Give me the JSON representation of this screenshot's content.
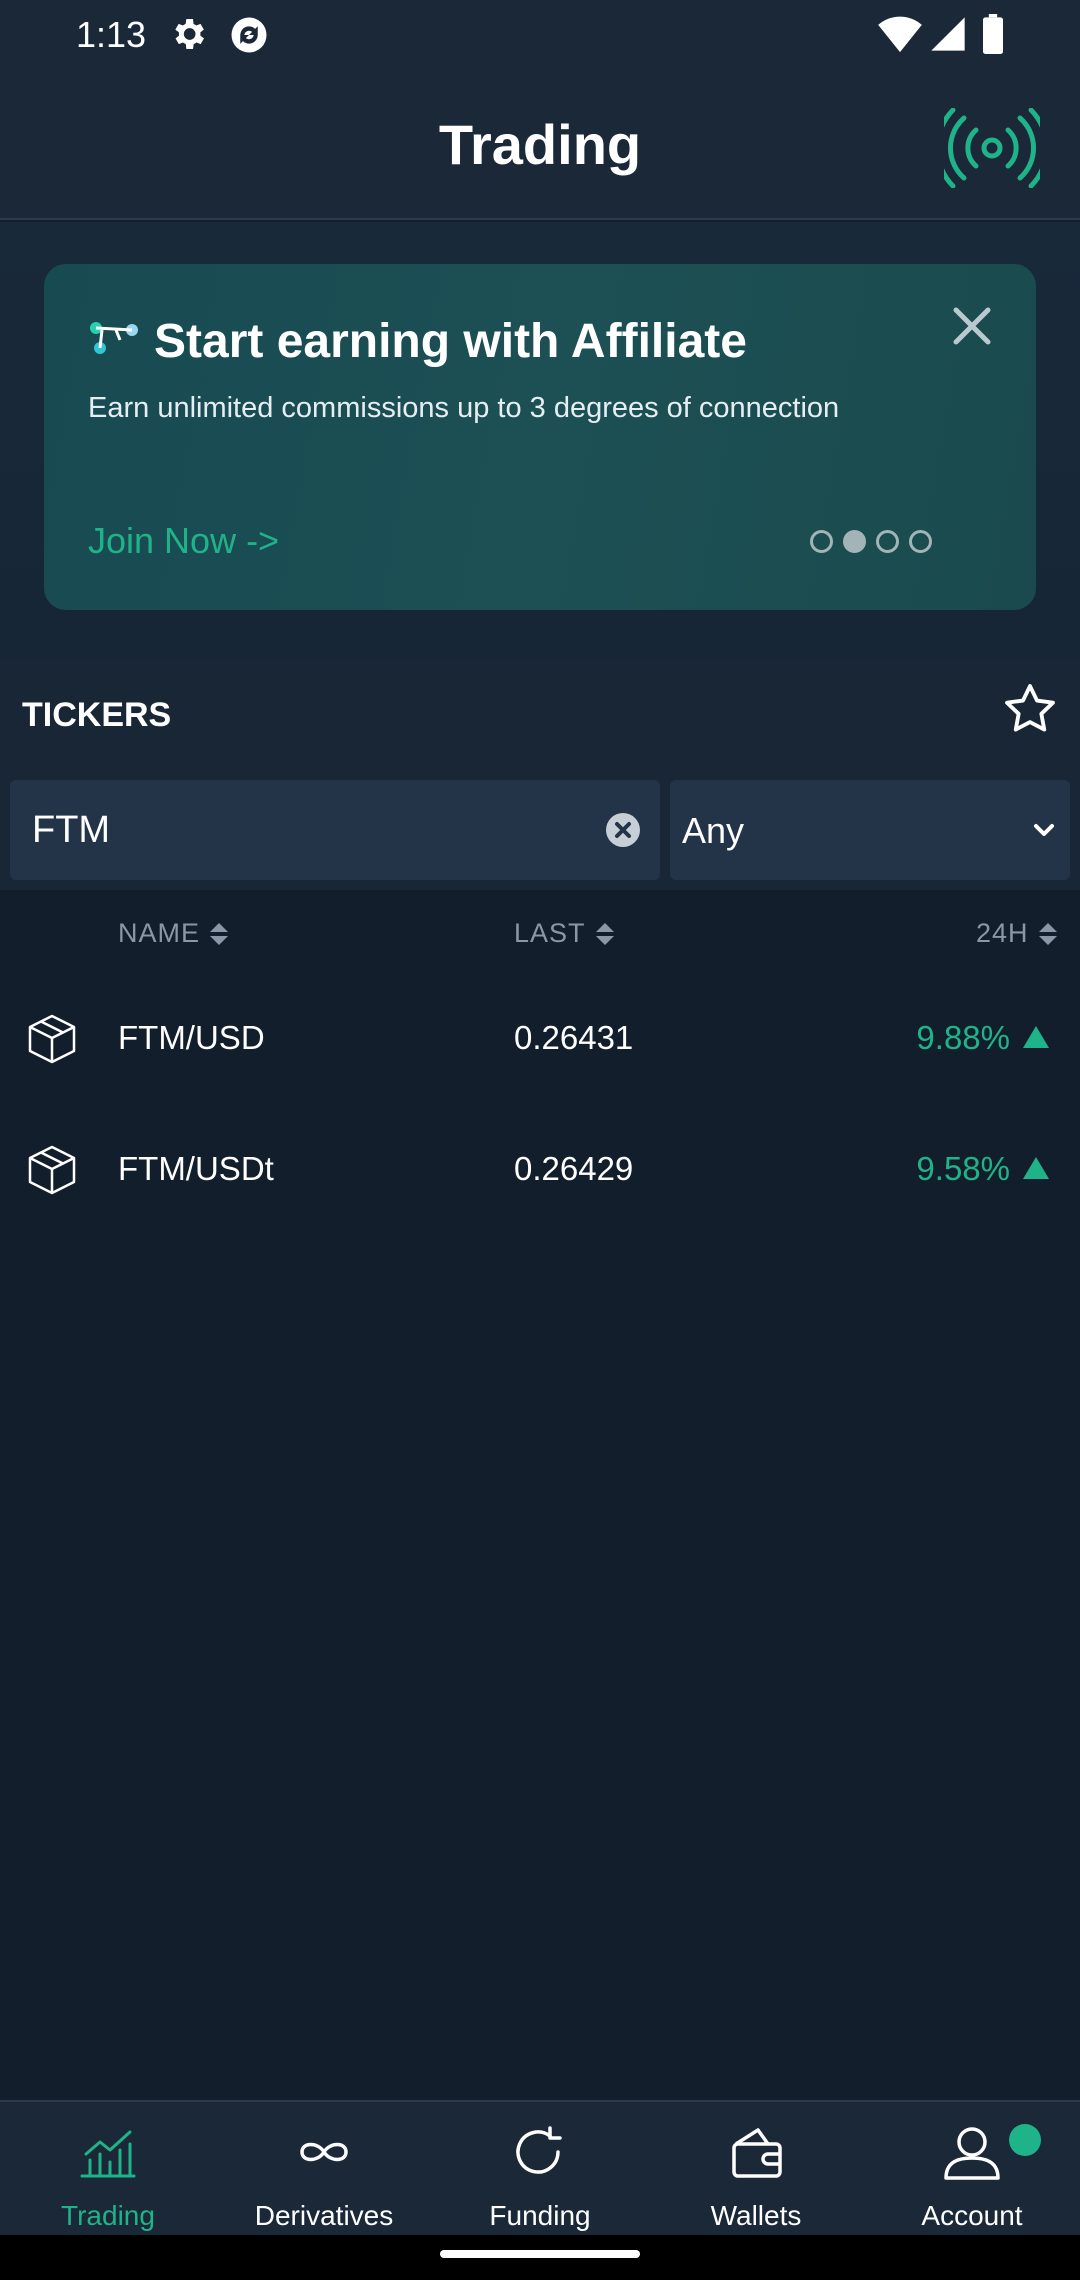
{
  "status_bar": {
    "time": "1:13",
    "icons": [
      "gear-icon",
      "sync-icon",
      "wifi-icon",
      "signal-icon",
      "battery-icon"
    ]
  },
  "header": {
    "title": "Trading",
    "live_icon": "broadcast-icon",
    "accent": "#1fb38a"
  },
  "banner": {
    "title": "Start earning with Affiliate",
    "description": "Earn unlimited commissions up to 3 degrees of connection",
    "cta": "Join Now ->",
    "pages": 4,
    "active_page": 2
  },
  "tickers": {
    "label": "TICKERS",
    "search": {
      "value": "FTM",
      "placeholder": ""
    },
    "filter": {
      "selected": "Any"
    },
    "columns": {
      "name": "NAME",
      "last": "LAST",
      "change": "24H"
    },
    "rows": [
      {
        "pair": "FTM/USD",
        "last": "0.26431",
        "change": "9.88%",
        "direction": "up"
      },
      {
        "pair": "FTM/USDt",
        "last": "0.26429",
        "change": "9.58%",
        "direction": "up"
      }
    ]
  },
  "bottom_nav": {
    "items": [
      {
        "label": "Trading",
        "icon": "chart-icon",
        "active": true
      },
      {
        "label": "Derivatives",
        "icon": "infinity-icon",
        "active": false
      },
      {
        "label": "Funding",
        "icon": "refresh-icon",
        "active": false
      },
      {
        "label": "Wallets",
        "icon": "wallet-icon",
        "active": false
      },
      {
        "label": "Account",
        "icon": "user-icon",
        "active": false
      }
    ]
  },
  "colors": {
    "background": "#131e2c",
    "positive": "#1fb38a",
    "panel": "#233449"
  }
}
